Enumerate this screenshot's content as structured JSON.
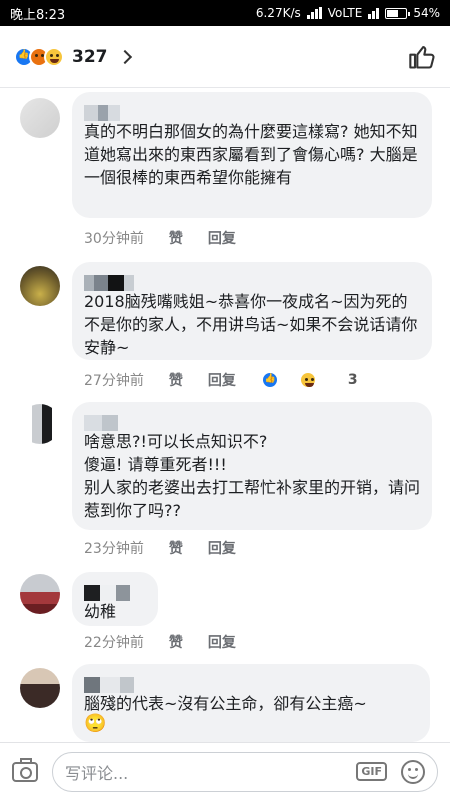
{
  "status_bar": {
    "time": "晚上8:23",
    "speed": "6.27K/s",
    "network": "VoLTE",
    "battery": "54%"
  },
  "reactions": {
    "count": "327",
    "types": [
      "like-icon",
      "angry-icon",
      "haha-icon"
    ]
  },
  "comments": [
    {
      "text": "真的不明白那個女的為什麼要這樣寫? 她知不知道她寫出來的東西家屬看到了會傷心嗎? 大腦是一個很棒的東西希望你能擁有",
      "time": "30分钟前",
      "like": "赞",
      "reply": "回复"
    },
    {
      "text": "2018脑残嘴贱姐~恭喜你一夜成名~因为死的不是你的家人，不用讲鸟话~如果不会说话请你安静~",
      "time": "27分钟前",
      "like": "赞",
      "reply": "回复",
      "reaction_count": "3"
    },
    {
      "text": "啥意思?!可以长点知识不?\n傻逼! 请尊重死者!!!\n别人家的老婆出去打工帮忙补家里的开销，请问惹到你了吗??",
      "time": "23分钟前",
      "like": "赞",
      "reply": "回复"
    },
    {
      "text": "幼稚",
      "time": "22分钟前",
      "like": "赞",
      "reply": "回复"
    },
    {
      "text": "腦殘的代表~沒有公主命，卻有公主癌~",
      "emoji": "🙄"
    }
  ],
  "composer": {
    "placeholder": "写评论...",
    "gif_label": "GIF"
  }
}
